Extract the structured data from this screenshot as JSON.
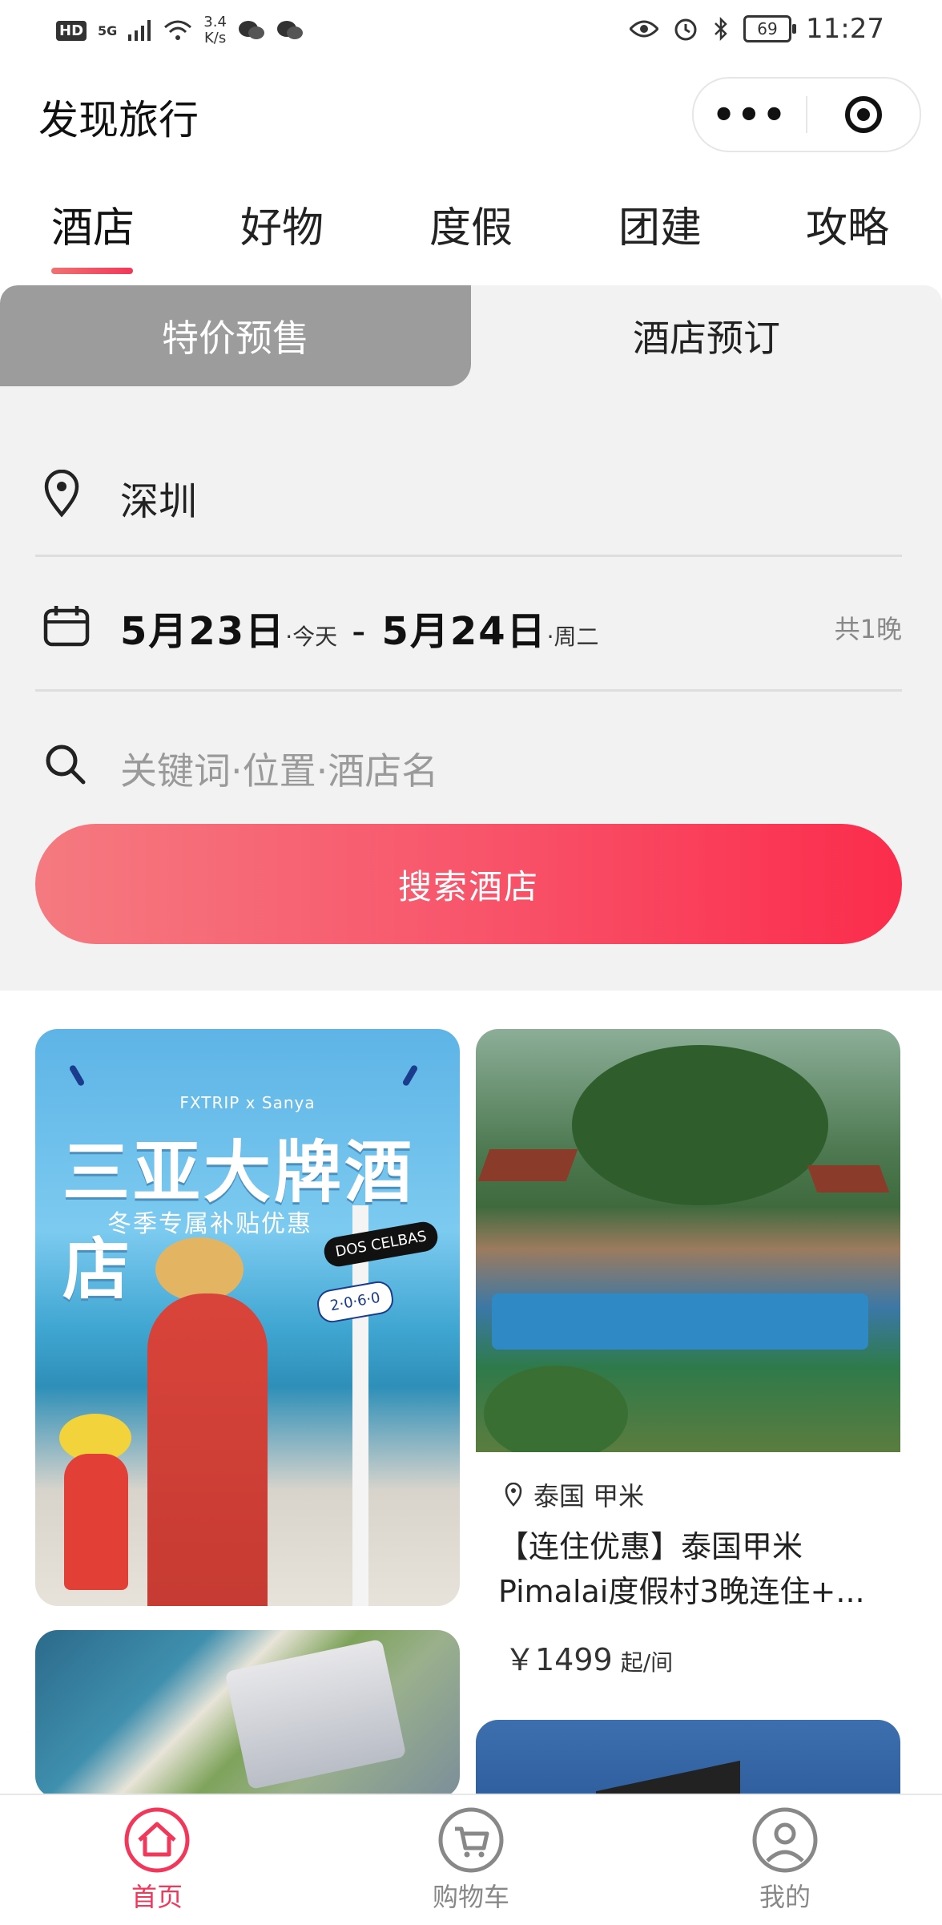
{
  "status_bar": {
    "hd": "HD",
    "network": "5G",
    "speed_value": "3.4",
    "speed_unit": "K/s",
    "battery": "69",
    "time": "11:27"
  },
  "header": {
    "title": "发现旅行",
    "more_label": "•••"
  },
  "category_tabs": [
    "酒店",
    "好物",
    "度假",
    "团建",
    "攻略"
  ],
  "segment": {
    "left": "特价预售",
    "right": "酒店预订"
  },
  "booking": {
    "city": "深圳",
    "checkin_date": "5月23日",
    "checkin_day": "·今天",
    "date_separator": "-",
    "checkout_date": "5月24日",
    "checkout_day": "·周二",
    "nights": "共1晚",
    "keyword_placeholder": "关键词·位置·酒店名",
    "search_button": "搜索酒店"
  },
  "promo_card": {
    "brand": "FXTRIP x Sanya",
    "title": "三亚大牌酒店",
    "subtitle": "冬季专属补贴优惠",
    "sign_1": "DOS CELBAS",
    "sign_2": "2·0·6·0"
  },
  "hotel_card": {
    "location": "泰国 甲米",
    "title": "【连住优惠】泰国甲米Pimalai度假村3晚连住+...",
    "price": "￥1499",
    "price_unit": "起/间"
  },
  "bottom_nav": [
    {
      "label": "首页",
      "icon": "home-icon",
      "active": true
    },
    {
      "label": "购物车",
      "icon": "cart-icon",
      "active": false
    },
    {
      "label": "我的",
      "icon": "profile-icon",
      "active": false
    }
  ],
  "colors": {
    "accent": "#f2375a",
    "search_gradient_start": "#f57a80",
    "search_gradient_end": "#fb2c4c",
    "segment_inactive": "#9c9c9c",
    "panel_bg": "#f3f2f3"
  }
}
